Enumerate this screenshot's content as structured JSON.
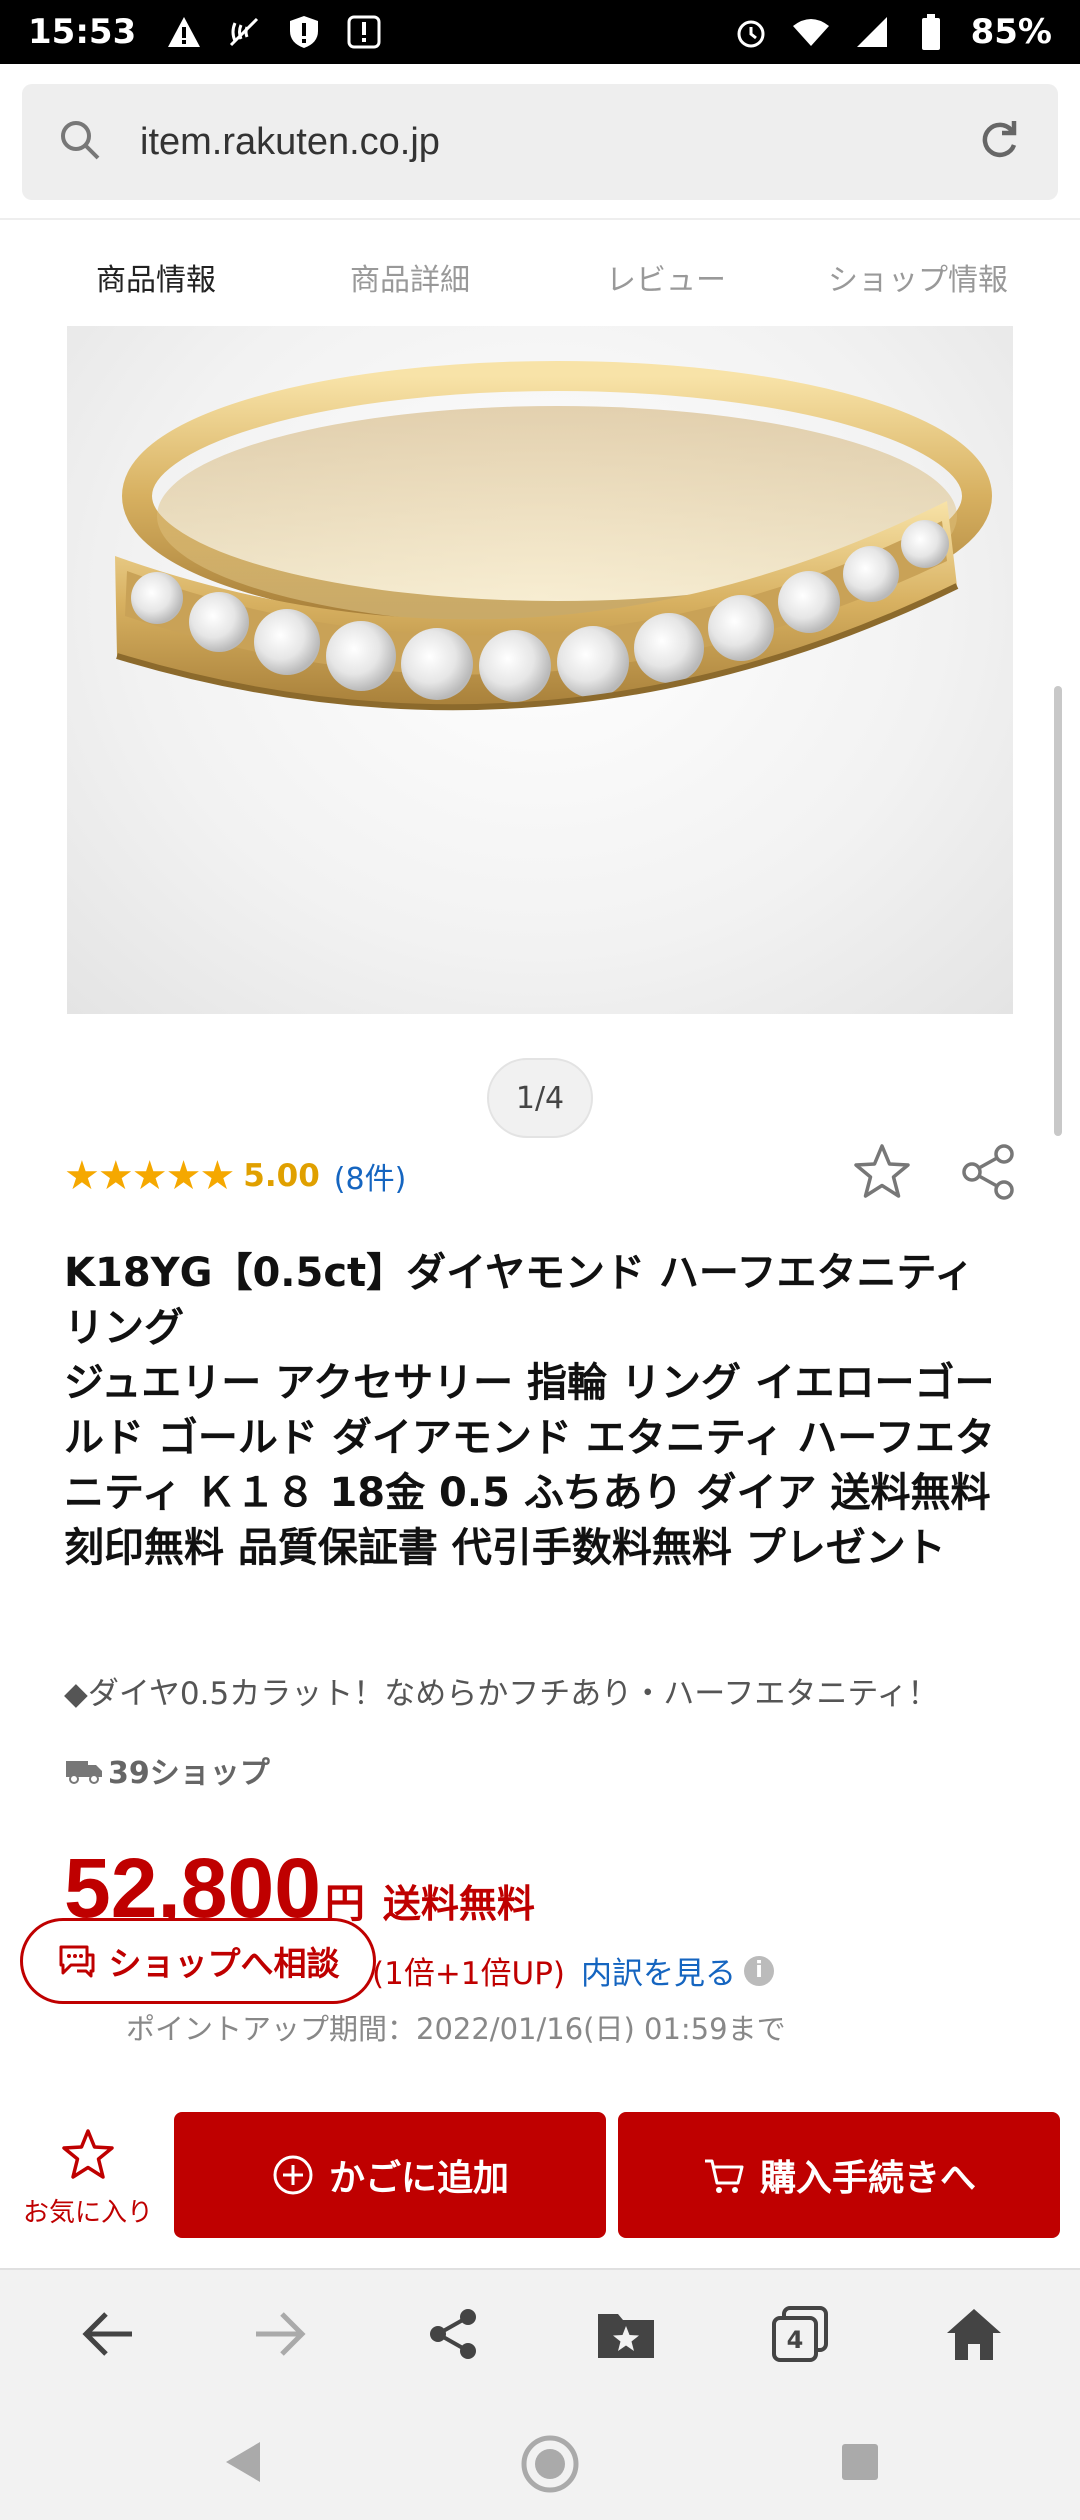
{
  "status_bar": {
    "time": "15:53",
    "battery": "85%"
  },
  "browser": {
    "url": "item.rakuten.co.jp",
    "tab_count": "4"
  },
  "tabs": [
    {
      "label": "商品情報"
    },
    {
      "label": "商品詳細"
    },
    {
      "label": "レビュー"
    },
    {
      "label": "ショップ情報"
    }
  ],
  "gallery": {
    "pager": "1/4"
  },
  "rating": {
    "stars": "★★★★★",
    "value": "5.00",
    "count": "(8件)",
    "score_fraction": 1.0
  },
  "product": {
    "title": "K18YG【0.5ct】ダイヤモンド ハーフエタニティリング\nジュエリー アクセサリー 指輪 リング イエローゴールド ゴールド ダイアモンド エタニティ ハーフエタニティ Ｋ１８ 18金 0.5 ふちあり ダイア 送料無料 刻印無料 品質保証書 代引手数料無料 プレゼント",
    "subtitle": "◆ダイヤ0.5カラット！なめらかフチあり・ハーフエタニティ！",
    "shop_badge": "39ショップ"
  },
  "price": {
    "amount": "52,800",
    "currency": "円",
    "shipping": "送料無料",
    "points": "(1倍+1倍UP)",
    "breakdown_link": "内訳を見る",
    "period": "ポイントアップ期間：2022/01/16(日) 01:59まで"
  },
  "consult_button": {
    "label": "ショップへ相談"
  },
  "actions": {
    "favorite": "お気に入り",
    "add_to_cart": "かごに追加",
    "checkout": "購入手続きへ"
  },
  "colors": {
    "brand_red": "#bf0000",
    "star": "#f5a800",
    "link": "#1565c0"
  }
}
